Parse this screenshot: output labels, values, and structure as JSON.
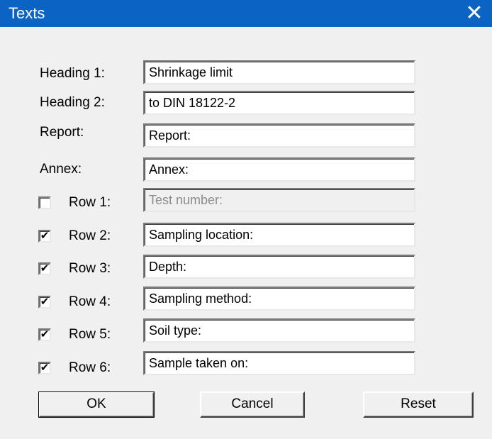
{
  "window": {
    "title": "Texts",
    "close_glyph": "✕"
  },
  "fields": {
    "heading1": {
      "label": "Heading 1:",
      "value": "Shrinkage limit"
    },
    "heading2": {
      "label": "Heading 2:",
      "value": "to DIN 18122-2"
    },
    "report": {
      "label": "Report:",
      "value": "Report:"
    },
    "annex": {
      "label": "Annex:",
      "value": "Annex:"
    }
  },
  "rows": [
    {
      "label": "Row 1:",
      "value": "Test number:",
      "checked": false,
      "enabled": false
    },
    {
      "label": "Row 2:",
      "value": "Sampling location:",
      "checked": true,
      "enabled": true
    },
    {
      "label": "Row 3:",
      "value": "Depth:",
      "checked": true,
      "enabled": true
    },
    {
      "label": "Row 4:",
      "value": "Sampling method:",
      "checked": true,
      "enabled": true
    },
    {
      "label": "Row 5:",
      "value": "Soil type:",
      "checked": true,
      "enabled": true
    },
    {
      "label": "Row 6:",
      "value": "Sample taken on:",
      "checked": true,
      "enabled": true
    }
  ],
  "check_glyph": "✔",
  "buttons": {
    "ok": "OK",
    "cancel": "Cancel",
    "reset": "Reset"
  },
  "colors": {
    "titlebar": "#0b63c4",
    "dialog_bg": "#f0f0f0"
  }
}
